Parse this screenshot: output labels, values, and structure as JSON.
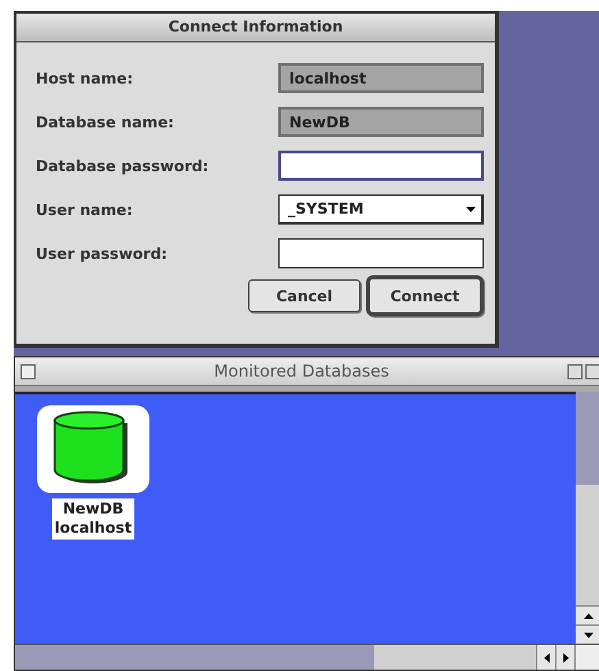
{
  "dialog": {
    "title": "Connect Information",
    "fields": [
      {
        "label": "Host name:",
        "kind": "text",
        "value": "localhost",
        "disabled": true,
        "focused": false
      },
      {
        "label": "Database name:",
        "kind": "text",
        "value": "NewDB",
        "disabled": true,
        "focused": false
      },
      {
        "label": "Database password:",
        "kind": "text",
        "disabled": false,
        "focused": true
      },
      {
        "label": "User name:",
        "kind": "select",
        "value": "_SYSTEM",
        "disabled": false,
        "focused": false
      },
      {
        "label": "User password:",
        "kind": "text",
        "disabled": false,
        "focused": false
      }
    ],
    "buttons": [
      {
        "label": "Cancel",
        "default": false
      },
      {
        "label": "Connect",
        "default": true
      }
    ]
  },
  "window": {
    "title": "Monitored Databases",
    "items": [
      {
        "name": "NewDB",
        "host": "localhost",
        "selected": true
      }
    ]
  }
}
